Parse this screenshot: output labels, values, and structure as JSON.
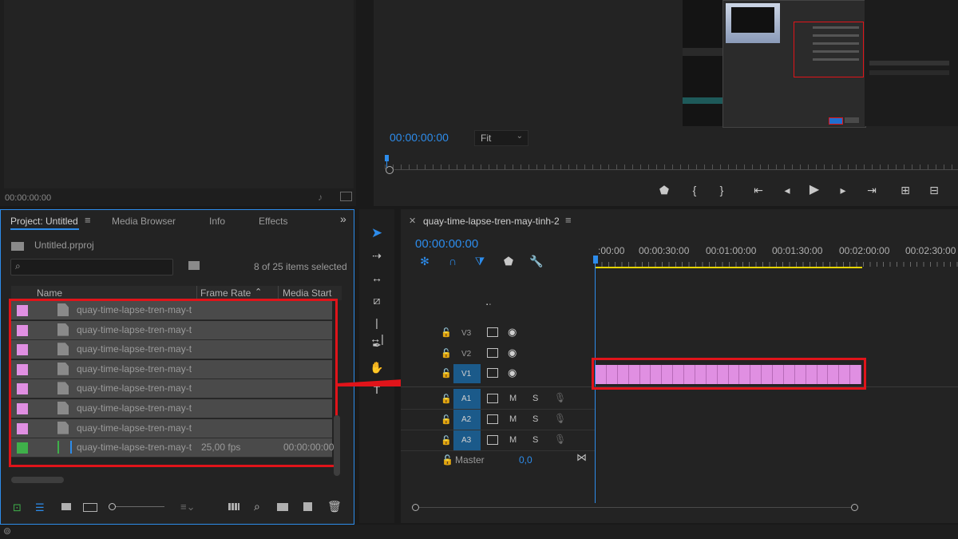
{
  "source_monitor": {
    "timecode": "00:00:00:00"
  },
  "program_monitor": {
    "timecode": "00:00:00:00",
    "zoom": "Fit"
  },
  "project_panel": {
    "tabs": [
      {
        "label": "Project: Untitled"
      },
      {
        "label": "Media Browser"
      },
      {
        "label": "Info"
      },
      {
        "label": "Effects"
      }
    ],
    "project_file": "Untitled.prproj",
    "search_placeholder": "",
    "selection_count": "8 of 25 items selected",
    "columns": [
      "Name",
      "Frame Rate",
      "Media Start"
    ],
    "items": [
      {
        "name": "quay-time-lapse-tren-may-t",
        "frame_rate": "",
        "media_start": "",
        "color": "#e08fe2",
        "type": "image"
      },
      {
        "name": "quay-time-lapse-tren-may-t",
        "frame_rate": "",
        "media_start": "",
        "color": "#e08fe2",
        "type": "image"
      },
      {
        "name": "quay-time-lapse-tren-may-t",
        "frame_rate": "",
        "media_start": "",
        "color": "#e08fe2",
        "type": "image"
      },
      {
        "name": "quay-time-lapse-tren-may-t",
        "frame_rate": "",
        "media_start": "",
        "color": "#e08fe2",
        "type": "image"
      },
      {
        "name": "quay-time-lapse-tren-may-t",
        "frame_rate": "",
        "media_start": "",
        "color": "#e08fe2",
        "type": "image"
      },
      {
        "name": "quay-time-lapse-tren-may-t",
        "frame_rate": "",
        "media_start": "",
        "color": "#e08fe2",
        "type": "image"
      },
      {
        "name": "quay-time-lapse-tren-may-t",
        "frame_rate": "",
        "media_start": "",
        "color": "#e08fe2",
        "type": "image"
      },
      {
        "name": "quay-time-lapse-tren-may-t",
        "frame_rate": "25,00 fps",
        "media_start": "00:00:00:00",
        "color": "#3fb04a",
        "type": "sequence"
      }
    ]
  },
  "timeline": {
    "sequence_name": "quay-time-lapse-tren-may-tinh-2",
    "timecode": "00:00:00:00",
    "ruler": [
      ":00:00",
      "00:00:30:00",
      "00:01:00:00",
      "00:01:30:00",
      "00:02:00:00",
      "00:02:30:00"
    ],
    "video_tracks": [
      "V3",
      "V2",
      "V1"
    ],
    "audio_tracks": [
      "A1",
      "A2",
      "A3"
    ],
    "mute_label": "M",
    "solo_label": "S",
    "master_label": "Master",
    "master_value": "0,0",
    "clip_color": "#e08fe2"
  },
  "colors": {
    "accent_blue": "#2d8ceb",
    "highlight_red": "#e0141a",
    "work_area_yellow": "#e6d400"
  }
}
